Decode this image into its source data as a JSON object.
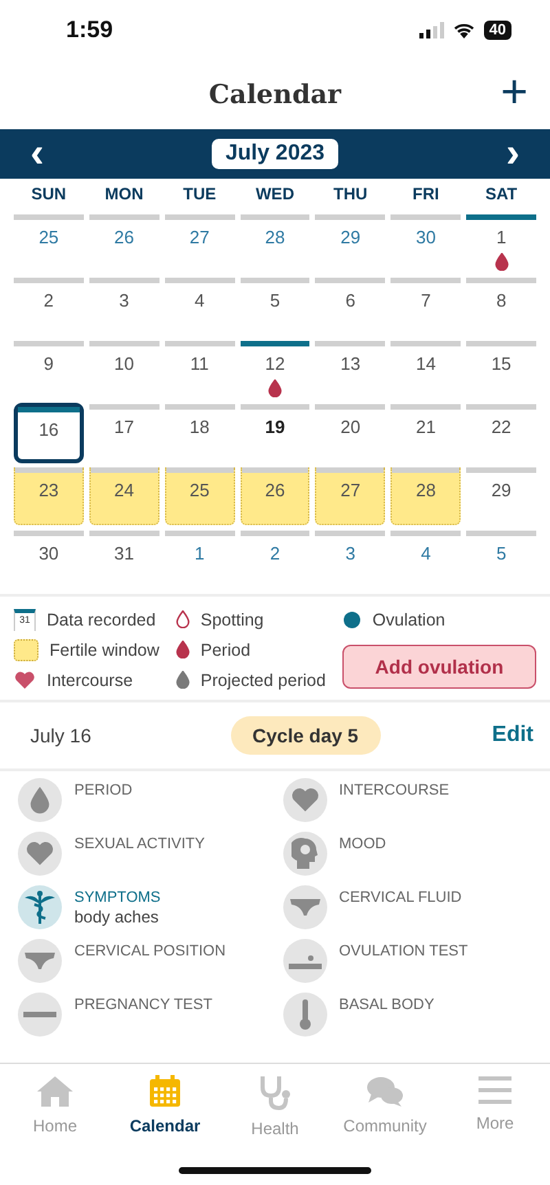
{
  "status_bar": {
    "time": "1:59",
    "battery": "40"
  },
  "header": {
    "title": "Calendar",
    "add_button": "+"
  },
  "month_bar": {
    "prev": "‹",
    "month": "July 2023",
    "next": "›"
  },
  "weekdays": [
    "SUN",
    "MON",
    "TUE",
    "WED",
    "THU",
    "FRI",
    "SAT"
  ],
  "days": [
    {
      "day": "25",
      "other_month": true,
      "recorded": false,
      "fertile": false,
      "period": false,
      "selected": false,
      "today": false
    },
    {
      "day": "26",
      "other_month": true,
      "recorded": false,
      "fertile": false,
      "period": false,
      "selected": false,
      "today": false
    },
    {
      "day": "27",
      "other_month": true,
      "recorded": false,
      "fertile": false,
      "period": false,
      "selected": false,
      "today": false
    },
    {
      "day": "28",
      "other_month": true,
      "recorded": false,
      "fertile": false,
      "period": false,
      "selected": false,
      "today": false
    },
    {
      "day": "29",
      "other_month": true,
      "recorded": false,
      "fertile": false,
      "period": false,
      "selected": false,
      "today": false
    },
    {
      "day": "30",
      "other_month": true,
      "recorded": false,
      "fertile": false,
      "period": false,
      "selected": false,
      "today": false
    },
    {
      "day": "1",
      "other_month": false,
      "recorded": true,
      "fertile": false,
      "period": true,
      "selected": false,
      "today": false
    },
    {
      "day": "2",
      "other_month": false,
      "recorded": false,
      "fertile": false,
      "period": false,
      "selected": false,
      "today": false
    },
    {
      "day": "3",
      "other_month": false,
      "recorded": false,
      "fertile": false,
      "period": false,
      "selected": false,
      "today": false
    },
    {
      "day": "4",
      "other_month": false,
      "recorded": false,
      "fertile": false,
      "period": false,
      "selected": false,
      "today": false
    },
    {
      "day": "5",
      "other_month": false,
      "recorded": false,
      "fertile": false,
      "period": false,
      "selected": false,
      "today": false
    },
    {
      "day": "6",
      "other_month": false,
      "recorded": false,
      "fertile": false,
      "period": false,
      "selected": false,
      "today": false
    },
    {
      "day": "7",
      "other_month": false,
      "recorded": false,
      "fertile": false,
      "period": false,
      "selected": false,
      "today": false
    },
    {
      "day": "8",
      "other_month": false,
      "recorded": false,
      "fertile": false,
      "period": false,
      "selected": false,
      "today": false
    },
    {
      "day": "9",
      "other_month": false,
      "recorded": false,
      "fertile": false,
      "period": false,
      "selected": false,
      "today": false
    },
    {
      "day": "10",
      "other_month": false,
      "recorded": false,
      "fertile": false,
      "period": false,
      "selected": false,
      "today": false
    },
    {
      "day": "11",
      "other_month": false,
      "recorded": false,
      "fertile": false,
      "period": false,
      "selected": false,
      "today": false
    },
    {
      "day": "12",
      "other_month": false,
      "recorded": true,
      "fertile": false,
      "period": true,
      "selected": false,
      "today": false
    },
    {
      "day": "13",
      "other_month": false,
      "recorded": false,
      "fertile": false,
      "period": false,
      "selected": false,
      "today": false
    },
    {
      "day": "14",
      "other_month": false,
      "recorded": false,
      "fertile": false,
      "period": false,
      "selected": false,
      "today": false
    },
    {
      "day": "15",
      "other_month": false,
      "recorded": false,
      "fertile": false,
      "period": false,
      "selected": false,
      "today": false
    },
    {
      "day": "16",
      "other_month": false,
      "recorded": true,
      "fertile": false,
      "period": false,
      "selected": true,
      "today": false
    },
    {
      "day": "17",
      "other_month": false,
      "recorded": false,
      "fertile": false,
      "period": false,
      "selected": false,
      "today": false
    },
    {
      "day": "18",
      "other_month": false,
      "recorded": false,
      "fertile": false,
      "period": false,
      "selected": false,
      "today": false
    },
    {
      "day": "19",
      "other_month": false,
      "recorded": false,
      "fertile": false,
      "period": false,
      "selected": false,
      "today": true
    },
    {
      "day": "20",
      "other_month": false,
      "recorded": false,
      "fertile": false,
      "period": false,
      "selected": false,
      "today": false
    },
    {
      "day": "21",
      "other_month": false,
      "recorded": false,
      "fertile": false,
      "period": false,
      "selected": false,
      "today": false
    },
    {
      "day": "22",
      "other_month": false,
      "recorded": false,
      "fertile": false,
      "period": false,
      "selected": false,
      "today": false
    },
    {
      "day": "23",
      "other_month": false,
      "recorded": false,
      "fertile": true,
      "period": false,
      "selected": false,
      "today": false
    },
    {
      "day": "24",
      "other_month": false,
      "recorded": false,
      "fertile": true,
      "period": false,
      "selected": false,
      "today": false
    },
    {
      "day": "25",
      "other_month": false,
      "recorded": false,
      "fertile": true,
      "period": false,
      "selected": false,
      "today": false
    },
    {
      "day": "26",
      "other_month": false,
      "recorded": false,
      "fertile": true,
      "period": false,
      "selected": false,
      "today": false
    },
    {
      "day": "27",
      "other_month": false,
      "recorded": false,
      "fertile": true,
      "period": false,
      "selected": false,
      "today": false
    },
    {
      "day": "28",
      "other_month": false,
      "recorded": false,
      "fertile": true,
      "period": false,
      "selected": false,
      "today": false
    },
    {
      "day": "29",
      "other_month": false,
      "recorded": false,
      "fertile": false,
      "period": false,
      "selected": false,
      "today": false
    },
    {
      "day": "30",
      "other_month": false,
      "recorded": false,
      "fertile": false,
      "period": false,
      "selected": false,
      "today": false
    },
    {
      "day": "31",
      "other_month": false,
      "recorded": false,
      "fertile": false,
      "period": false,
      "selected": false,
      "today": false
    },
    {
      "day": "1",
      "other_month": true,
      "recorded": false,
      "fertile": false,
      "period": false,
      "selected": false,
      "today": false
    },
    {
      "day": "2",
      "other_month": true,
      "recorded": false,
      "fertile": false,
      "period": false,
      "selected": false,
      "today": false
    },
    {
      "day": "3",
      "other_month": true,
      "recorded": false,
      "fertile": false,
      "period": false,
      "selected": false,
      "today": false
    },
    {
      "day": "4",
      "other_month": true,
      "recorded": false,
      "fertile": false,
      "period": false,
      "selected": false,
      "today": false
    },
    {
      "day": "5",
      "other_month": true,
      "recorded": false,
      "fertile": false,
      "period": false,
      "selected": false,
      "today": false
    }
  ],
  "legend": [
    {
      "kind": "recorded",
      "label": "Data recorded",
      "icon_text": "31"
    },
    {
      "kind": "spotting",
      "label": "Spotting"
    },
    {
      "kind": "ovulation",
      "label": "Ovulation"
    },
    {
      "kind": "fertile",
      "label": "Fertile window"
    },
    {
      "kind": "period",
      "label": "Period"
    },
    {
      "kind": "intercourse",
      "label": "Intercourse"
    },
    {
      "kind": "projected",
      "label": "Projected period"
    }
  ],
  "add_ovulation": "Add ovulation",
  "day_summary": {
    "date": "July 16",
    "cycle_day": "Cycle day 5",
    "edit": "Edit"
  },
  "log_items": [
    {
      "label": "PERIOD",
      "active": false
    },
    {
      "label": "INTERCOURSE",
      "active": false
    },
    {
      "label": "SEXUAL ACTIVITY",
      "active": false
    },
    {
      "label": "MOOD",
      "active": false
    },
    {
      "label": "SYMPTOMS",
      "value": "body aches",
      "active": true
    },
    {
      "label": "CERVICAL FLUID",
      "active": false
    },
    {
      "label": "CERVICAL POSITION",
      "active": false
    },
    {
      "label": "OVULATION TEST",
      "active": false
    },
    {
      "label": "PREGNANCY TEST",
      "active": false
    },
    {
      "label": "BASAL BODY",
      "active": false
    }
  ],
  "tabs": [
    {
      "label": "Home",
      "selected": false
    },
    {
      "label": "Calendar",
      "selected": true
    },
    {
      "label": "Health",
      "selected": false
    },
    {
      "label": "Community",
      "selected": false
    },
    {
      "label": "More",
      "selected": false
    }
  ]
}
